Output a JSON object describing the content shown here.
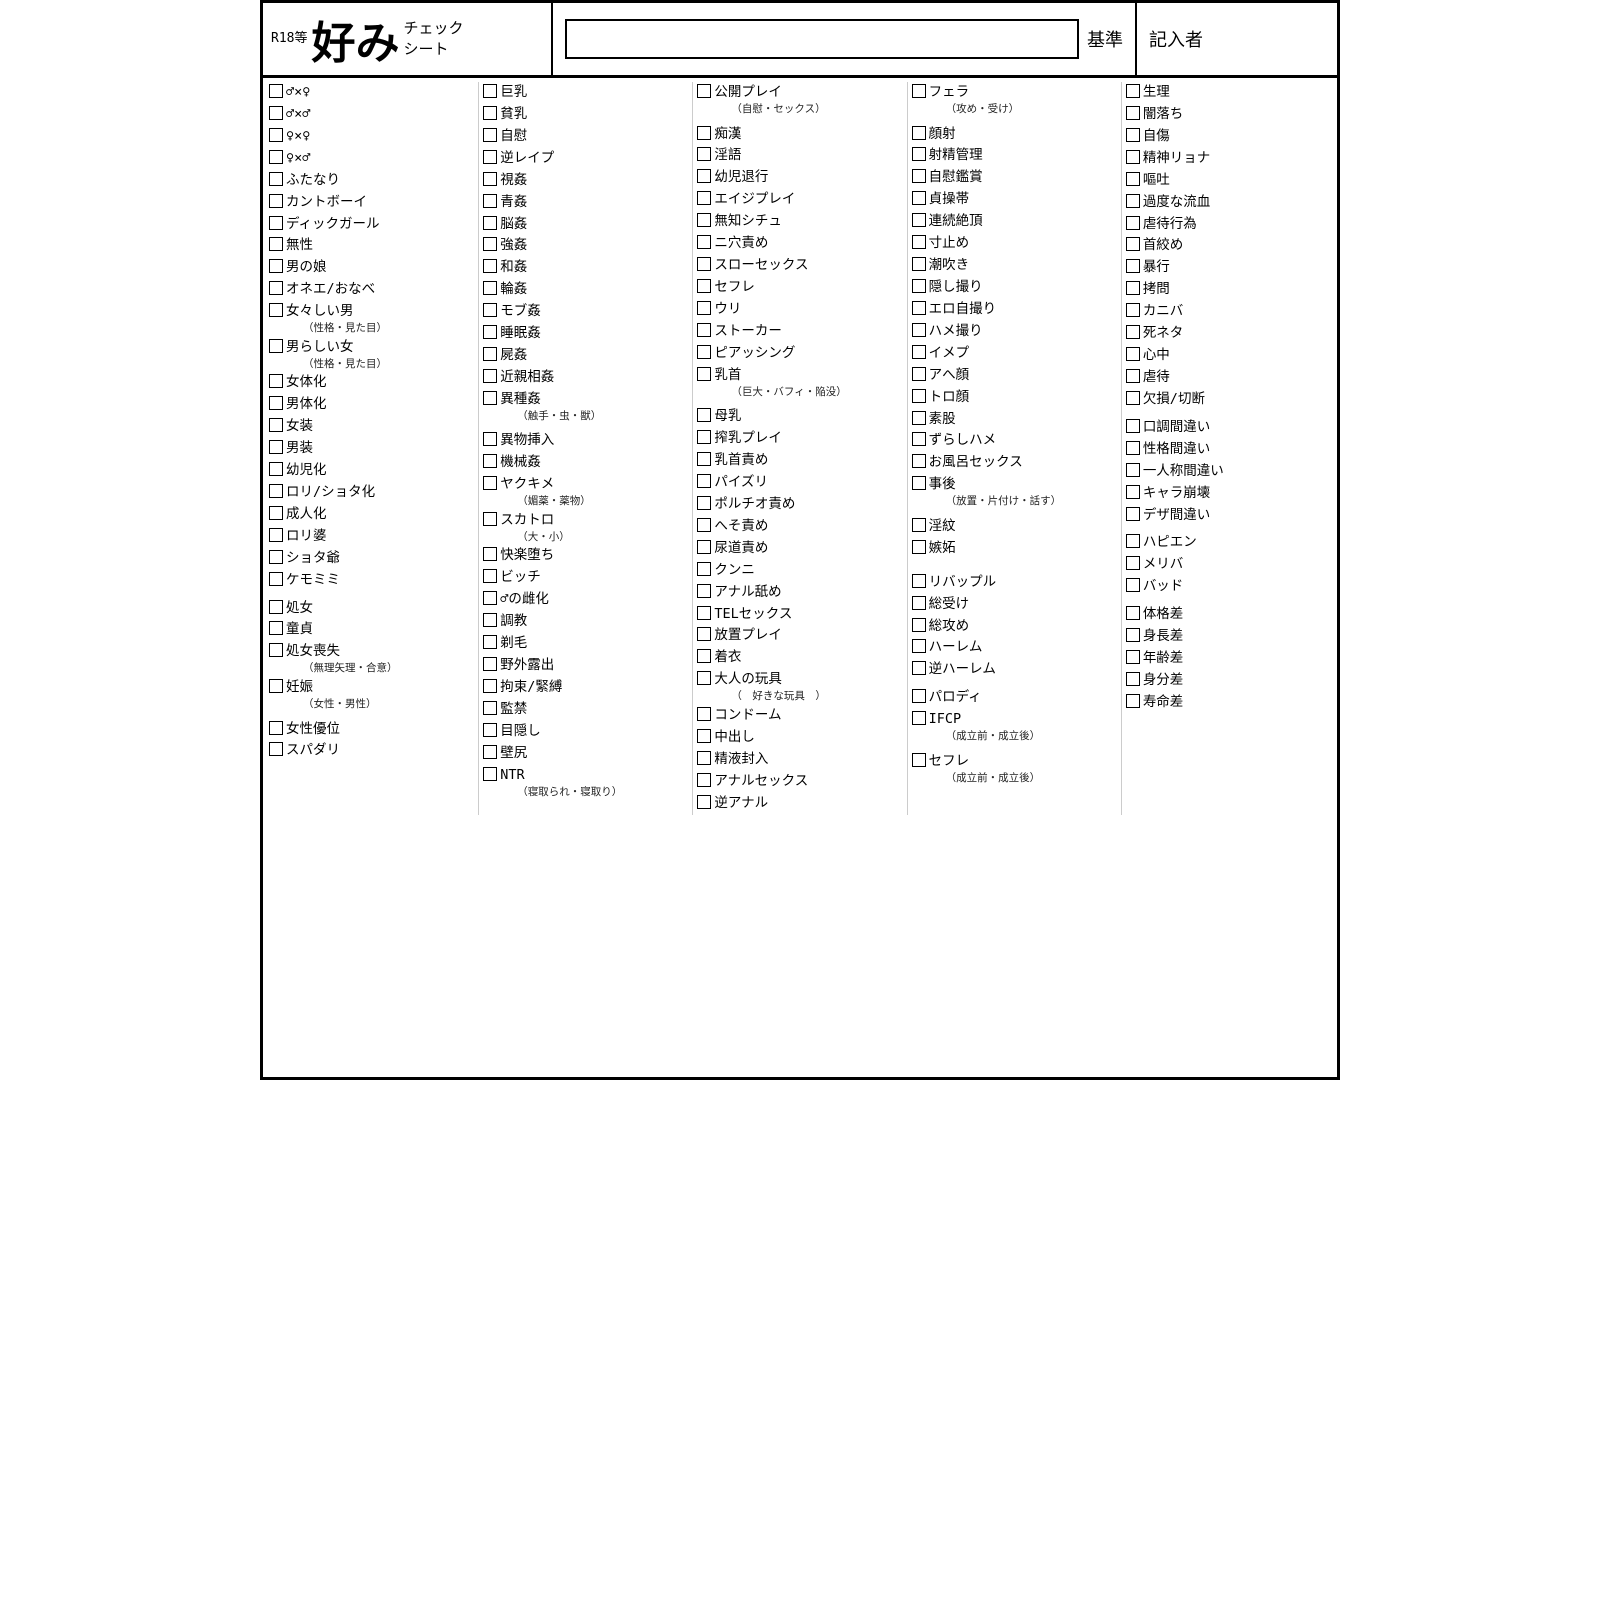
{
  "header": {
    "title_small1": "R18等",
    "title_big": "好み",
    "title_small2": "チェック\nシート",
    "kijun_label": "基準",
    "kishaname_label": "記入者"
  },
  "col1": [
    {
      "text": "♂×♀"
    },
    {
      "text": "♂×♂"
    },
    {
      "text": "♀×♀"
    },
    {
      "text": "♀×♂"
    },
    {
      "text": "ふたなり"
    },
    {
      "text": "カントボーイ"
    },
    {
      "text": "ディックガール"
    },
    {
      "text": "無性"
    },
    {
      "text": "男の娘"
    },
    {
      "text": "オネエ/おなべ"
    },
    {
      "text": "女々しい男",
      "sub": "（性格・見た目）"
    },
    {
      "text": "男らしい女",
      "sub": "（性格・見た目）"
    },
    {
      "text": "女体化"
    },
    {
      "text": "男体化"
    },
    {
      "text": "女装"
    },
    {
      "text": "男装"
    },
    {
      "text": "幼児化"
    },
    {
      "text": "ロリ/ショタ化"
    },
    {
      "text": "成人化"
    },
    {
      "text": "ロリ婆"
    },
    {
      "text": "ショタ爺"
    },
    {
      "text": "ケモミミ"
    },
    {
      "spacer": true
    },
    {
      "text": "処女"
    },
    {
      "text": "童貞"
    },
    {
      "text": "処女喪失",
      "sub": "（無理矢理・合意）"
    },
    {
      "text": "妊娠",
      "sub": "（女性・男性）"
    },
    {
      "spacer": true
    },
    {
      "text": "女性優位"
    },
    {
      "text": "スパダリ"
    }
  ],
  "col2": [
    {
      "text": "巨乳"
    },
    {
      "text": "貧乳"
    },
    {
      "text": "自慰"
    },
    {
      "text": "逆レイプ"
    },
    {
      "text": "視姦"
    },
    {
      "text": "青姦"
    },
    {
      "text": "脳姦"
    },
    {
      "text": "強姦"
    },
    {
      "text": "和姦"
    },
    {
      "text": "輪姦"
    },
    {
      "text": "モブ姦"
    },
    {
      "text": "睡眠姦"
    },
    {
      "text": "屍姦"
    },
    {
      "text": "近親相姦"
    },
    {
      "text": "異種姦",
      "sub": "（触手・虫・獣）"
    },
    {
      "spacer": true
    },
    {
      "text": "異物挿入"
    },
    {
      "text": "機械姦"
    },
    {
      "text": "ヤクキメ",
      "sub": "（媚薬・薬物）"
    },
    {
      "text": "スカトロ",
      "sub": "（大・小）"
    },
    {
      "text": "快楽堕ち"
    },
    {
      "text": "ビッチ"
    },
    {
      "text": "♂の雌化"
    },
    {
      "text": "調教"
    },
    {
      "text": "剃毛"
    },
    {
      "text": "野外露出"
    },
    {
      "text": "拘束/緊縛"
    },
    {
      "text": "監禁"
    },
    {
      "text": "目隠し"
    },
    {
      "text": "壁尻"
    },
    {
      "text": "NTR",
      "sub": "（寝取られ・寝取り）"
    }
  ],
  "col3": [
    {
      "text": "公開プレイ",
      "sub": "（自慰・セックス）"
    },
    {
      "spacer": true
    },
    {
      "text": "痴漢"
    },
    {
      "text": "淫語"
    },
    {
      "text": "幼児退行"
    },
    {
      "text": "エイジプレイ"
    },
    {
      "text": "無知シチュ"
    },
    {
      "text": "ニ穴責め"
    },
    {
      "text": "スローセックス"
    },
    {
      "text": "セフレ"
    },
    {
      "text": "ウリ"
    },
    {
      "text": "ストーカー"
    },
    {
      "text": "ピアッシング"
    },
    {
      "text": "乳首",
      "sub": "（巨大・バフィ・陥没）"
    },
    {
      "spacer": true
    },
    {
      "text": "母乳"
    },
    {
      "text": "搾乳プレイ"
    },
    {
      "text": "乳首責め"
    },
    {
      "text": "パイズリ"
    },
    {
      "text": "ポルチオ責め"
    },
    {
      "text": "へそ責め"
    },
    {
      "text": "尿道責め"
    },
    {
      "text": "クンニ"
    },
    {
      "text": "アナル舐め"
    },
    {
      "text": "TELセックス"
    },
    {
      "text": "放置プレイ"
    },
    {
      "text": "着衣"
    },
    {
      "text": "大人の玩具",
      "sub": "（　好きな玩具　）"
    },
    {
      "text": "コンドーム"
    },
    {
      "text": "中出し"
    },
    {
      "text": "精液封入"
    },
    {
      "text": "アナルセックス"
    },
    {
      "text": "逆アナル"
    }
  ],
  "col4": [
    {
      "text": "フェラ",
      "sub": "（攻め・受け）"
    },
    {
      "spacer": true
    },
    {
      "text": "顔射"
    },
    {
      "text": "射精管理"
    },
    {
      "text": "自慰鑑賞"
    },
    {
      "text": "貞操帯"
    },
    {
      "text": "連続絶頂"
    },
    {
      "text": "寸止め"
    },
    {
      "text": "潮吹き"
    },
    {
      "text": "隠し撮り"
    },
    {
      "text": "エロ自撮り"
    },
    {
      "text": "ハメ撮り"
    },
    {
      "text": "イメプ"
    },
    {
      "text": "アへ顔"
    },
    {
      "text": "トロ顔"
    },
    {
      "text": "素股"
    },
    {
      "text": "ずらしハメ"
    },
    {
      "text": "お風呂セックス"
    },
    {
      "text": "事後",
      "sub": "（放置・片付け・話す）"
    },
    {
      "spacer": true
    },
    {
      "text": "淫紋"
    },
    {
      "text": "嫉妬"
    },
    {
      "spacer": true
    },
    {
      "spacer": true
    },
    {
      "text": "リバップル"
    },
    {
      "text": "総受け"
    },
    {
      "text": "総攻め"
    },
    {
      "text": "ハーレム"
    },
    {
      "text": "逆ハーレム"
    },
    {
      "spacer": true
    },
    {
      "text": "パロディ"
    },
    {
      "text": "IFCP",
      "sub": "（成立前・成立後）"
    },
    {
      "spacer": true
    },
    {
      "text": "セフレ",
      "sub": "（成立前・成立後）"
    }
  ],
  "col5": [
    {
      "text": "生理"
    },
    {
      "text": "闇落ち"
    },
    {
      "text": "自傷"
    },
    {
      "text": "精神リョナ"
    },
    {
      "text": "嘔吐"
    },
    {
      "text": "過度な流血"
    },
    {
      "text": "虐待行為"
    },
    {
      "text": "首絞め"
    },
    {
      "text": "暴行"
    },
    {
      "text": "拷問"
    },
    {
      "text": "カニバ"
    },
    {
      "text": "死ネタ"
    },
    {
      "text": "心中"
    },
    {
      "text": "虐待"
    },
    {
      "text": "欠損/切断"
    },
    {
      "spacer": true
    },
    {
      "text": "口調間違い"
    },
    {
      "text": "性格間違い"
    },
    {
      "text": "一人称間違い"
    },
    {
      "text": "キャラ崩壊"
    },
    {
      "text": "デザ間違い"
    },
    {
      "spacer": true
    },
    {
      "text": "ハピエン"
    },
    {
      "text": "メリバ"
    },
    {
      "text": "バッド"
    },
    {
      "spacer": true
    },
    {
      "text": "体格差"
    },
    {
      "text": "身長差"
    },
    {
      "text": "年齢差"
    },
    {
      "text": "身分差"
    },
    {
      "text": "寿命差"
    }
  ]
}
